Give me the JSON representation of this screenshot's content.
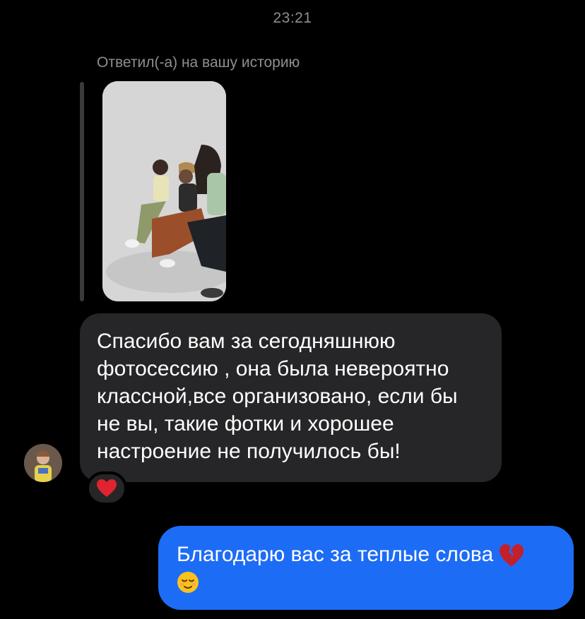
{
  "header": {
    "timestamp": "23:21"
  },
  "story_reply": {
    "label": "Ответил(-а) на вашу историю"
  },
  "messages": {
    "incoming": {
      "text": "Спасибо вам за сегодняшнюю фотосессию , она была невероятно классной,все организовано, если бы не вы, такие фотки и хорошее настроение не получилось бы!",
      "reaction_icon": "red-heart-icon"
    },
    "outgoing": {
      "text": "Благодарю вас за теплые слова",
      "emoji_icons": [
        "broken-heart-icon",
        "relieved-face-icon"
      ]
    }
  },
  "colors": {
    "background": "#000000",
    "incoming_bubble": "#262628",
    "outgoing_bubble": "#1d6cf6",
    "muted_text": "#8e8e93",
    "heart": "#e0242f"
  }
}
